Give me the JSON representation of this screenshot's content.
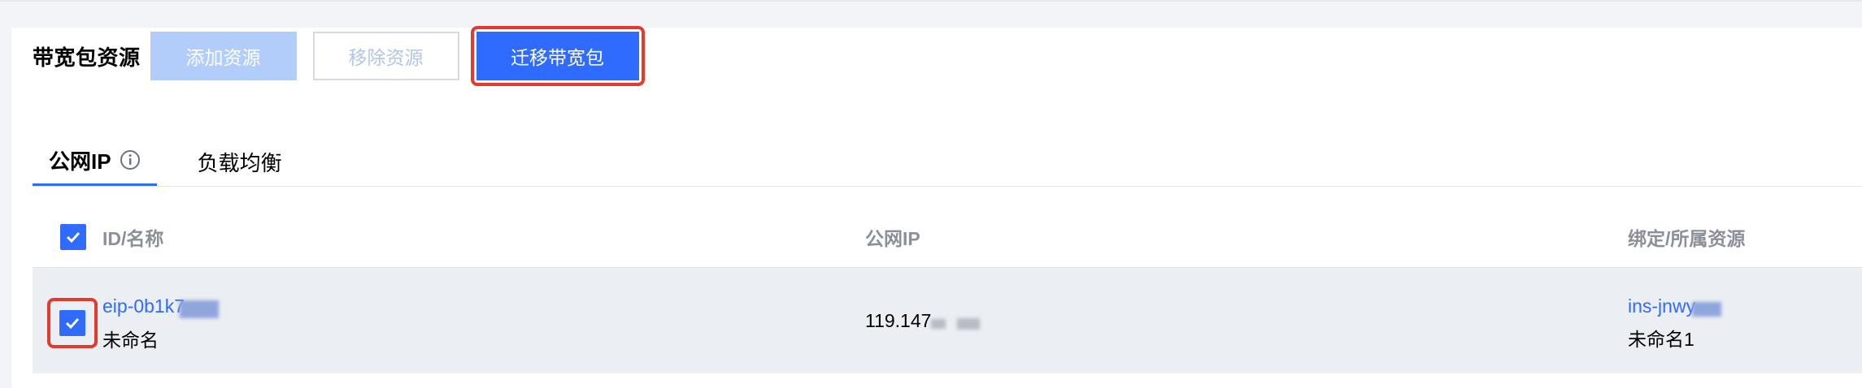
{
  "section": {
    "title": "带宽包资源",
    "buttons": {
      "add": "添加资源",
      "remove": "移除资源",
      "migrate": "迁移带宽包"
    }
  },
  "tabs": [
    {
      "label": "公网IP",
      "active": true
    },
    {
      "label": "负载均衡",
      "active": false
    }
  ],
  "table": {
    "columns": [
      "ID/名称",
      "公网IP",
      "绑定/所属资源"
    ],
    "rows": [
      {
        "id": "eip-0b1k7",
        "name": "未命名",
        "public_ip": "119.147",
        "resource_id": "ins-jnwy",
        "resource_name": "未命名1",
        "checked": true
      }
    ]
  },
  "colors": {
    "primary": "#2f6bff",
    "primary_disabled": "#b3cdfa",
    "highlight_border": "#e23b2e"
  }
}
